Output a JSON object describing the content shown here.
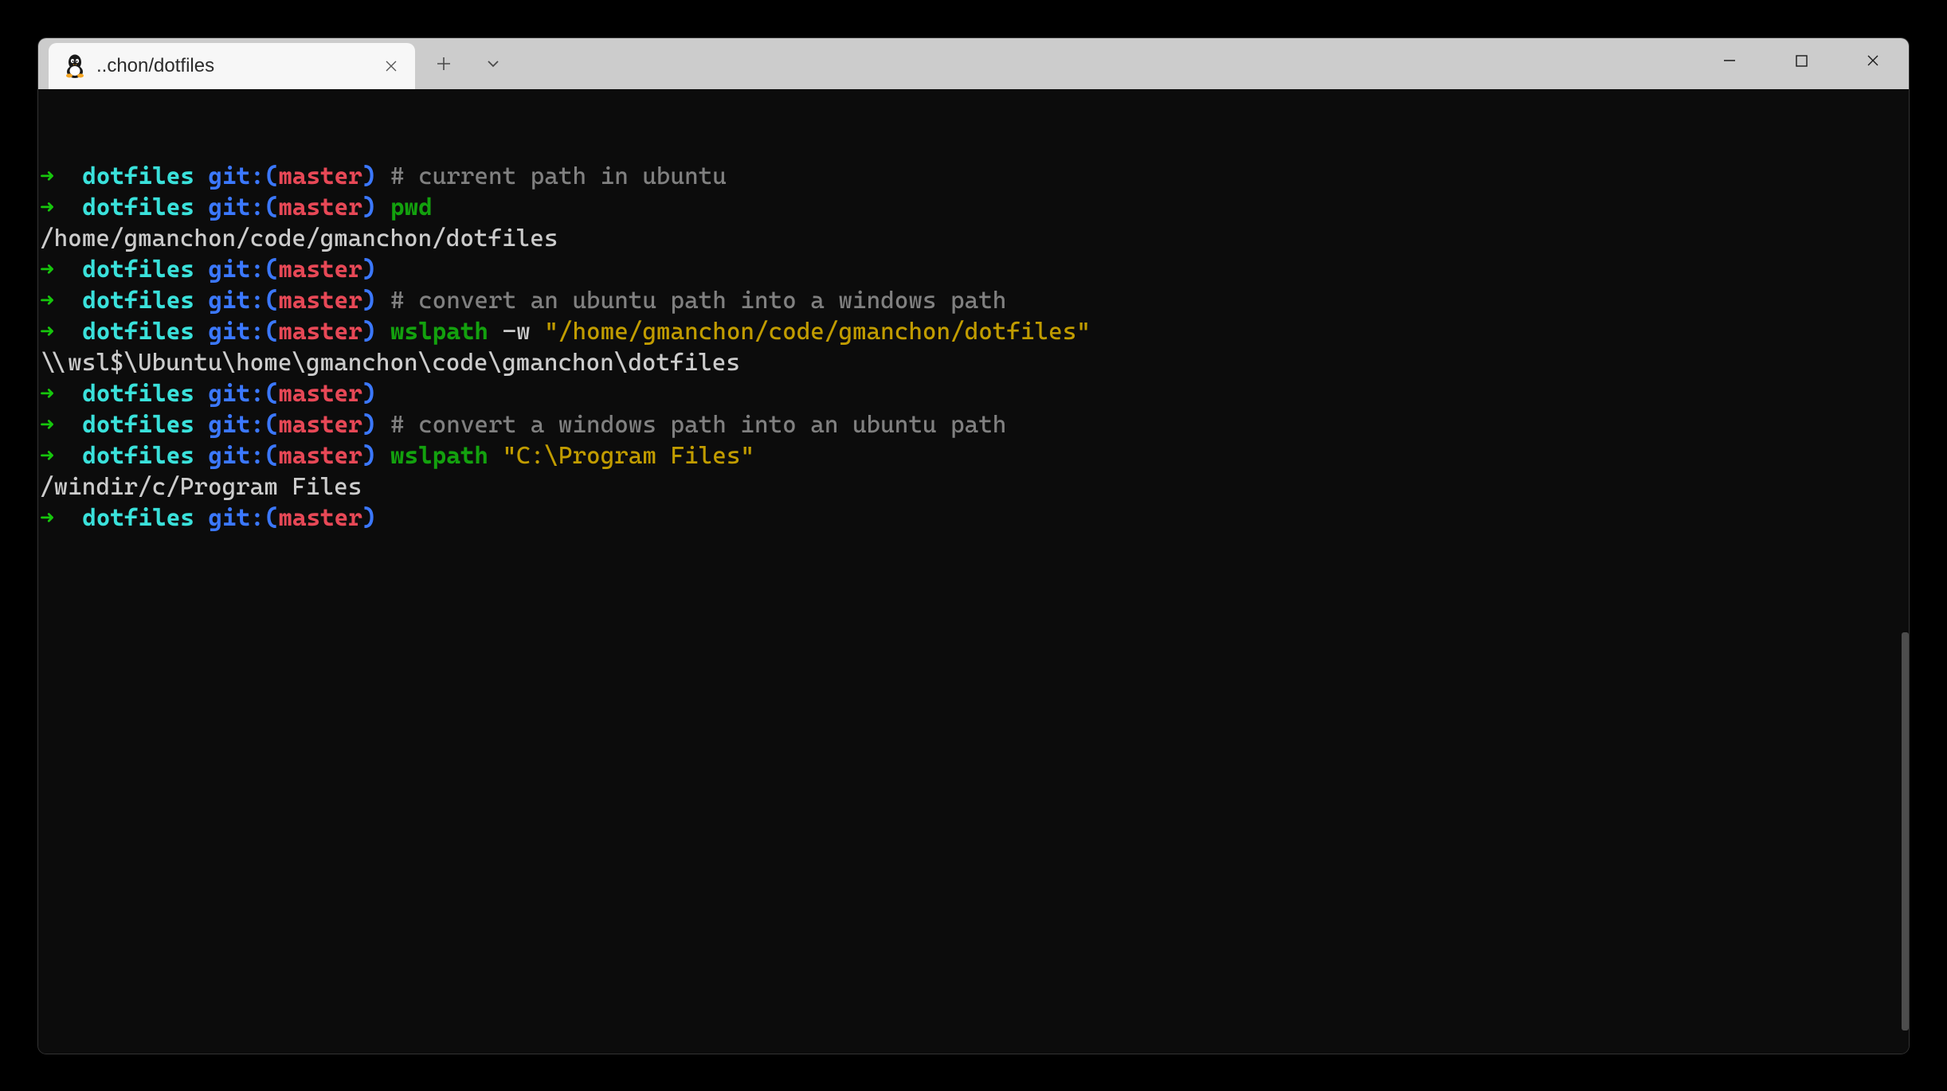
{
  "tab": {
    "title": "..chon/dotfiles"
  },
  "prompt": {
    "arrow": "➜",
    "dir": "dotfiles",
    "git_label": "git:",
    "paren_open": "(",
    "branch": "master",
    "paren_close": ")"
  },
  "lines": [
    {
      "type": "prompt",
      "kind": "comment",
      "text": "# current path in ubuntu"
    },
    {
      "type": "prompt",
      "kind": "cmd",
      "cmd": "pwd",
      "args": []
    },
    {
      "type": "output",
      "text": "/home/gmanchon/code/gmanchon/dotfiles"
    },
    {
      "type": "prompt",
      "kind": "empty"
    },
    {
      "type": "prompt",
      "kind": "comment",
      "text": "# convert an ubuntu path into a windows path"
    },
    {
      "type": "prompt",
      "kind": "cmd",
      "cmd": "wslpath",
      "flag": "-w",
      "string": "\"/home/gmanchon/code/gmanchon/dotfiles\""
    },
    {
      "type": "output",
      "text": "\\\\wsl$\\Ubuntu\\home\\gmanchon\\code\\gmanchon\\dotfiles"
    },
    {
      "type": "prompt",
      "kind": "empty"
    },
    {
      "type": "prompt",
      "kind": "comment",
      "text": "# convert a windows path into an ubuntu path"
    },
    {
      "type": "prompt",
      "kind": "cmd",
      "cmd": "wslpath",
      "string": "\"C:\\Program Files\""
    },
    {
      "type": "output",
      "text": "/windir/c/Program Files"
    },
    {
      "type": "prompt",
      "kind": "empty"
    }
  ],
  "colors": {
    "arrow": "#16c60c",
    "dir": "#3ae1db",
    "git": "#3b78ff",
    "branch": "#e74856",
    "comment": "#808080",
    "cmd": "#13a10e",
    "string": "#c19c00",
    "output": "#cccccc",
    "bg": "#0c0c0c"
  }
}
